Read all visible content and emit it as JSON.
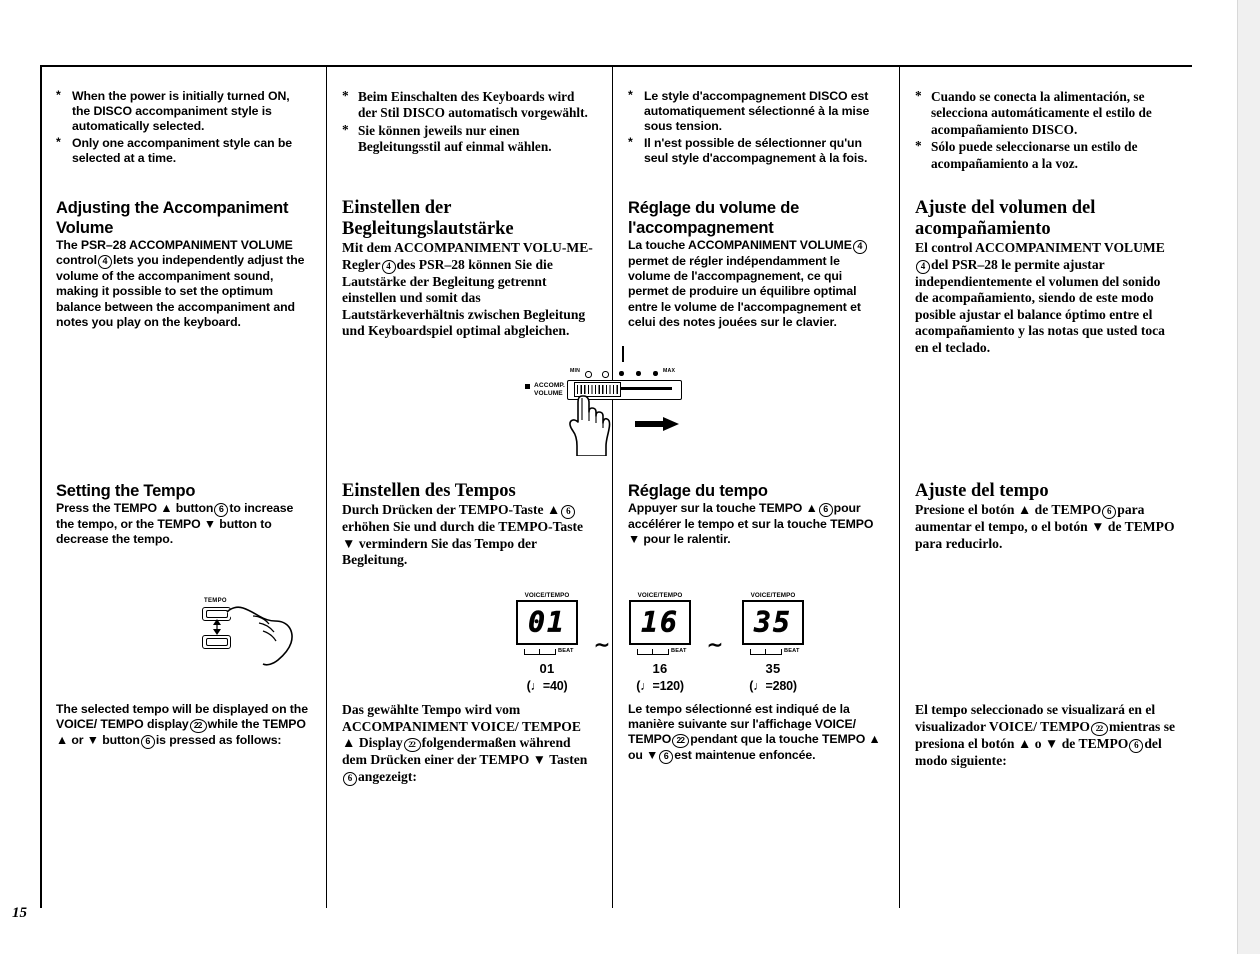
{
  "page": {
    "number": "15"
  },
  "columns": [
    {
      "lang": "en",
      "style": "sans",
      "bullets": [
        "When the power is initially turned ON, the DISCO accompaniment style is automatically selected.",
        "Only one accompaniment style can be selected at a time."
      ],
      "heading1": "Adjusting the Accompaniment Volume",
      "body1_a": "The PSR–28 ACCOMPANIMENT VOLUME control",
      "body1_ref": "4",
      "body1_b": "lets you independently adjust the volume of the accompaniment sound, making it possible to set the optimum balance between the accompaniment and notes you play on the keyboard.",
      "heading2": "Setting the Tempo",
      "body2_a": "Press the TEMPO ▲ button",
      "body2_ref": "6",
      "body2_b": "to increase the tempo, or the TEMPO ▼ button to decrease the tempo.",
      "body3_a": "The selected tempo will be displayed on the VOICE/ TEMPO display",
      "body3_ref1": "22",
      "body3_b": "while the TEMPO ▲ or ▼ button",
      "body3_ref2": "6",
      "body3_c": "is pressed as follows:"
    },
    {
      "lang": "de",
      "style": "serif",
      "bullets": [
        "Beim Einschalten des Keyboards wird der Stil DISCO automatisch vorgewählt.",
        "Sie können jeweils nur einen Begleitungsstil auf einmal wählen."
      ],
      "heading1": "Einstellen der Begleitungslautstärke",
      "body1_a": "Mit dem ACCOMPANIMENT VOLU-ME-Regler",
      "body1_ref": "4",
      "body1_b": "des PSR–28 können Sie die Lautstärke der Begleitung getrennt einstellen und somit das Lautstärkeverhältnis zwischen Begleitung und Keyboardspiel optimal abgleichen.",
      "heading2": "Einstellen des Tempos",
      "body2_a": "Durch Drücken der TEMPO-Taste ▲",
      "body2_ref": "6",
      "body2_b": "erhöhen Sie und durch die TEMPO-Taste ▼ vermindern Sie das Tempo der Begleitung.",
      "body3_a": "Das gewählte Tempo wird vom ACCOMPANIMENT VOICE/ TEMPOE ▲ Display",
      "body3_ref1": "22",
      "body3_b": "folgendermaßen während dem Drücken einer der TEMPO ▼ Tasten",
      "body3_ref2": "6",
      "body3_c": "angezeigt:"
    },
    {
      "lang": "fr",
      "style": "sans",
      "bullets": [
        "Le style d'accompagnement DISCO est automatiquement sélectionné à la mise sous tension.",
        "Il n'est possible de sélectionner qu'un seul style d'accompagnement à la fois."
      ],
      "heading1": "Réglage du volume de l'accompagnement",
      "body1_a": "La touche ACCOMPANIMENT VOLUME",
      "body1_ref": "4",
      "body1_b": "permet de régler indépendamment le volume de l'accompagnement, ce qui permet de produire un équilibre optimal entre le volume de l'accompagnement et celui des notes jouées sur le clavier.",
      "heading2": "Réglage du tempo",
      "body2_a": "Appuyer sur la touche TEMPO ▲",
      "body2_ref": "6",
      "body2_b": "pour accélérer le tempo et sur la touche TEMPO ▼ pour le ralentir.",
      "body3_a": "Le tempo sélectionné est indiqué de la manière suivante sur l'affichage VOICE/ TEMPO",
      "body3_ref1": "22",
      "body3_b": "pendant que la touche TEMPO ▲ ou ▼",
      "body3_ref2": "6",
      "body3_c": "est maintenue enfoncée."
    },
    {
      "lang": "es",
      "style": "serif",
      "bullets": [
        "Cuando se conecta la alimentación, se selecciona automáticamente el estilo de acompañamiento DISCO.",
        "Sólo puede seleccionarse un estilo de acompañamiento a la voz."
      ],
      "heading1": "Ajuste del volumen del acompañamiento",
      "body1_a": "El control ACCOMPANIMENT VOLUME",
      "body1_ref": "4",
      "body1_b": "del PSR–28 le permite ajustar independientemente el volumen del sonido de acompañamiento, siendo de este modo posible ajustar el balance óptimo entre el acompañamiento y las notas que usted toca en el teclado.",
      "heading2": "Ajuste del tempo",
      "body2_a": "Presione el botón ▲ de TEMPO",
      "body2_ref": "6",
      "body2_b": "para aumentar el tempo, o el botón ▼ de TEMPO para reducirlo.",
      "body3_a": "El tempo seleccionado se visualizará en el visualizador VOICE/ TEMPO",
      "body3_ref1": "22",
      "body3_b": "mientras se presiona el botón ▲ o ▼ de TEMPO",
      "body3_ref2": "6",
      "body3_c": "del modo siguiente:"
    }
  ],
  "slider_figure": {
    "label_line1": "ACCOMP.",
    "label_line2": "VOLUME",
    "min_label": "MIN",
    "max_label": "MAX"
  },
  "tempo_figure": {
    "caption": "TEMPO"
  },
  "lcd_figures": [
    {
      "caption": "VOICE/TEMPO",
      "digits": "01",
      "beat_label": "BEAT",
      "number": "01",
      "bpm": "(♩=40)"
    },
    {
      "caption": "VOICE/TEMPO",
      "digits": "16",
      "beat_label": "BEAT",
      "number": "16",
      "bpm": "(♩=120)"
    },
    {
      "caption": "VOICE/TEMPO",
      "digits": "35",
      "beat_label": "BEAT",
      "number": "35",
      "bpm": "(♩=280)"
    }
  ],
  "tilde_separator": "∼"
}
